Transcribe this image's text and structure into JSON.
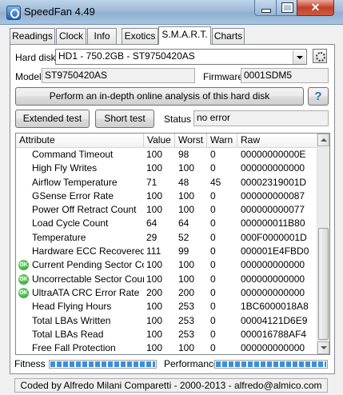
{
  "window": {
    "title": "SpeedFan 4.49"
  },
  "tabs": [
    {
      "label": "Readings"
    },
    {
      "label": "Clock"
    },
    {
      "label": "Info"
    },
    {
      "label": "Exotics"
    },
    {
      "label": "S.M.A.R.T."
    },
    {
      "label": "Charts"
    }
  ],
  "active_tab": "S.M.A.R.T.",
  "harddisk": {
    "label": "Hard disk",
    "selected": "HD1 - 750.2GB - ST9750420AS",
    "model_label": "Model",
    "model": "ST9750420AS",
    "firmware_label": "Firmware",
    "firmware": "0001SDM5"
  },
  "analysis_button": "Perform an in-depth online analysis of this hard disk",
  "help_icon": "?",
  "tests": {
    "extended": "Extended test",
    "short": "Short test",
    "status_label": "Status",
    "status_value": "no error"
  },
  "table": {
    "headers": [
      "Attribute",
      "Value",
      "Worst",
      "Warn",
      "Raw"
    ],
    "rows": [
      {
        "status": "",
        "attribute": "Command Timeout",
        "value": "100",
        "worst": "98",
        "warn": "0",
        "raw": "00000000000E"
      },
      {
        "status": "",
        "attribute": "High Fly Writes",
        "value": "100",
        "worst": "100",
        "warn": "0",
        "raw": "000000000000"
      },
      {
        "status": "",
        "attribute": "Airflow Temperature",
        "value": "71",
        "worst": "48",
        "warn": "45",
        "raw": "00002319001D"
      },
      {
        "status": "",
        "attribute": "GSense Error Rate",
        "value": "100",
        "worst": "100",
        "warn": "0",
        "raw": "000000000087"
      },
      {
        "status": "",
        "attribute": "Power Off Retract Count",
        "value": "100",
        "worst": "100",
        "warn": "0",
        "raw": "000000000077"
      },
      {
        "status": "",
        "attribute": "Load Cycle Count",
        "value": "64",
        "worst": "64",
        "warn": "0",
        "raw": "000000011B80"
      },
      {
        "status": "",
        "attribute": "Temperature",
        "value": "29",
        "worst": "52",
        "warn": "0",
        "raw": "000F0000001D"
      },
      {
        "status": "",
        "attribute": "Hardware ECC Recovered",
        "value": "111",
        "worst": "99",
        "warn": "0",
        "raw": "000001E4FBD0"
      },
      {
        "status": "OK",
        "attribute": "Current Pending Sector Co...",
        "value": "100",
        "worst": "100",
        "warn": "0",
        "raw": "000000000000"
      },
      {
        "status": "OK",
        "attribute": "Uncorrectable Sector Count",
        "value": "100",
        "worst": "100",
        "warn": "0",
        "raw": "000000000000"
      },
      {
        "status": "OK",
        "attribute": "UltraATA CRC Error Rate",
        "value": "200",
        "worst": "200",
        "warn": "0",
        "raw": "000000000000"
      },
      {
        "status": "",
        "attribute": "Head Flying Hours",
        "value": "100",
        "worst": "253",
        "warn": "0",
        "raw": "1BC6000018A8"
      },
      {
        "status": "",
        "attribute": "Total LBAs Written",
        "value": "100",
        "worst": "253",
        "warn": "0",
        "raw": "00004121D6E9"
      },
      {
        "status": "",
        "attribute": "Total LBAs Read",
        "value": "100",
        "worst": "253",
        "warn": "0",
        "raw": "000016788AF4"
      },
      {
        "status": "",
        "attribute": "Free Fall Protection",
        "value": "100",
        "worst": "100",
        "warn": "0",
        "raw": "000000000000"
      }
    ]
  },
  "fitness": {
    "label": "Fitness",
    "level": 1.0
  },
  "performance": {
    "label": "Performance",
    "level": 1.0
  },
  "statusbar": "Coded by Alfredo Milani Comparetti - 2000-2013 - alfredo@almico.com",
  "colors": {
    "meter": "#3b8fe0",
    "ok": "#1e9a1e",
    "close": "#c4402b"
  }
}
